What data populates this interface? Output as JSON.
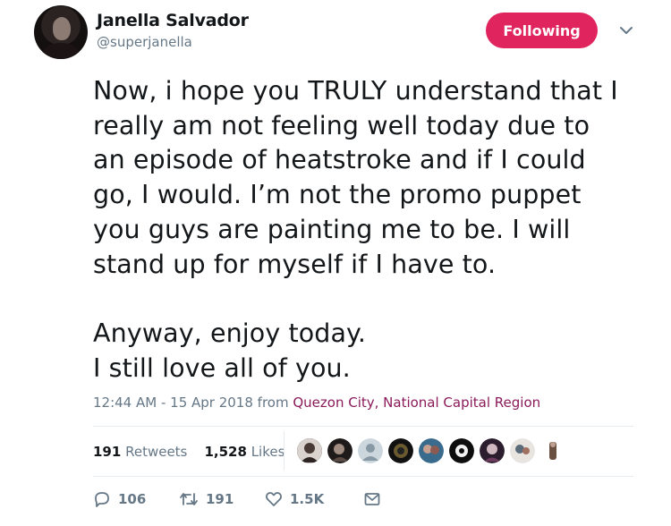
{
  "user": {
    "name": "Janella Salvador",
    "handle": "@superjanella"
  },
  "follow_button": {
    "label": "Following",
    "color": "#e0245e"
  },
  "tweet": {
    "text": "Now, i hope you TRULY understand that I\nreally am not feeling well today due to\nan episode of heatstroke and if I could\ngo, I would. I’m not the promo puppet\nyou guys are painting me to be. I will\nstand up for myself if I have to.\n\nAnyway, enjoy today.\nI still love all of you."
  },
  "meta": {
    "timestamp": "12:44 AM - 15 Apr 2018 from",
    "location": "Quezon City, National Capital Region"
  },
  "stats": {
    "retweets_count": "191",
    "retweets_label": "Retweets",
    "likes_count": "1,528",
    "likes_label": "Likes"
  },
  "likers": [
    {
      "icon": "liker-avatar-1"
    },
    {
      "icon": "liker-avatar-2"
    },
    {
      "icon": "default-avatar"
    },
    {
      "icon": "liker-avatar-4"
    },
    {
      "icon": "liker-avatar-5"
    },
    {
      "icon": "liker-avatar-6"
    },
    {
      "icon": "liker-avatar-7"
    },
    {
      "icon": "liker-avatar-8"
    },
    {
      "icon": "liker-avatar-9"
    }
  ],
  "actions": {
    "replies": "106",
    "retweets": "191",
    "likes": "1.5K"
  },
  "colors": {
    "accent": "#e0245e",
    "secondary_text": "#657786",
    "location_link": "#8b1a5a"
  }
}
